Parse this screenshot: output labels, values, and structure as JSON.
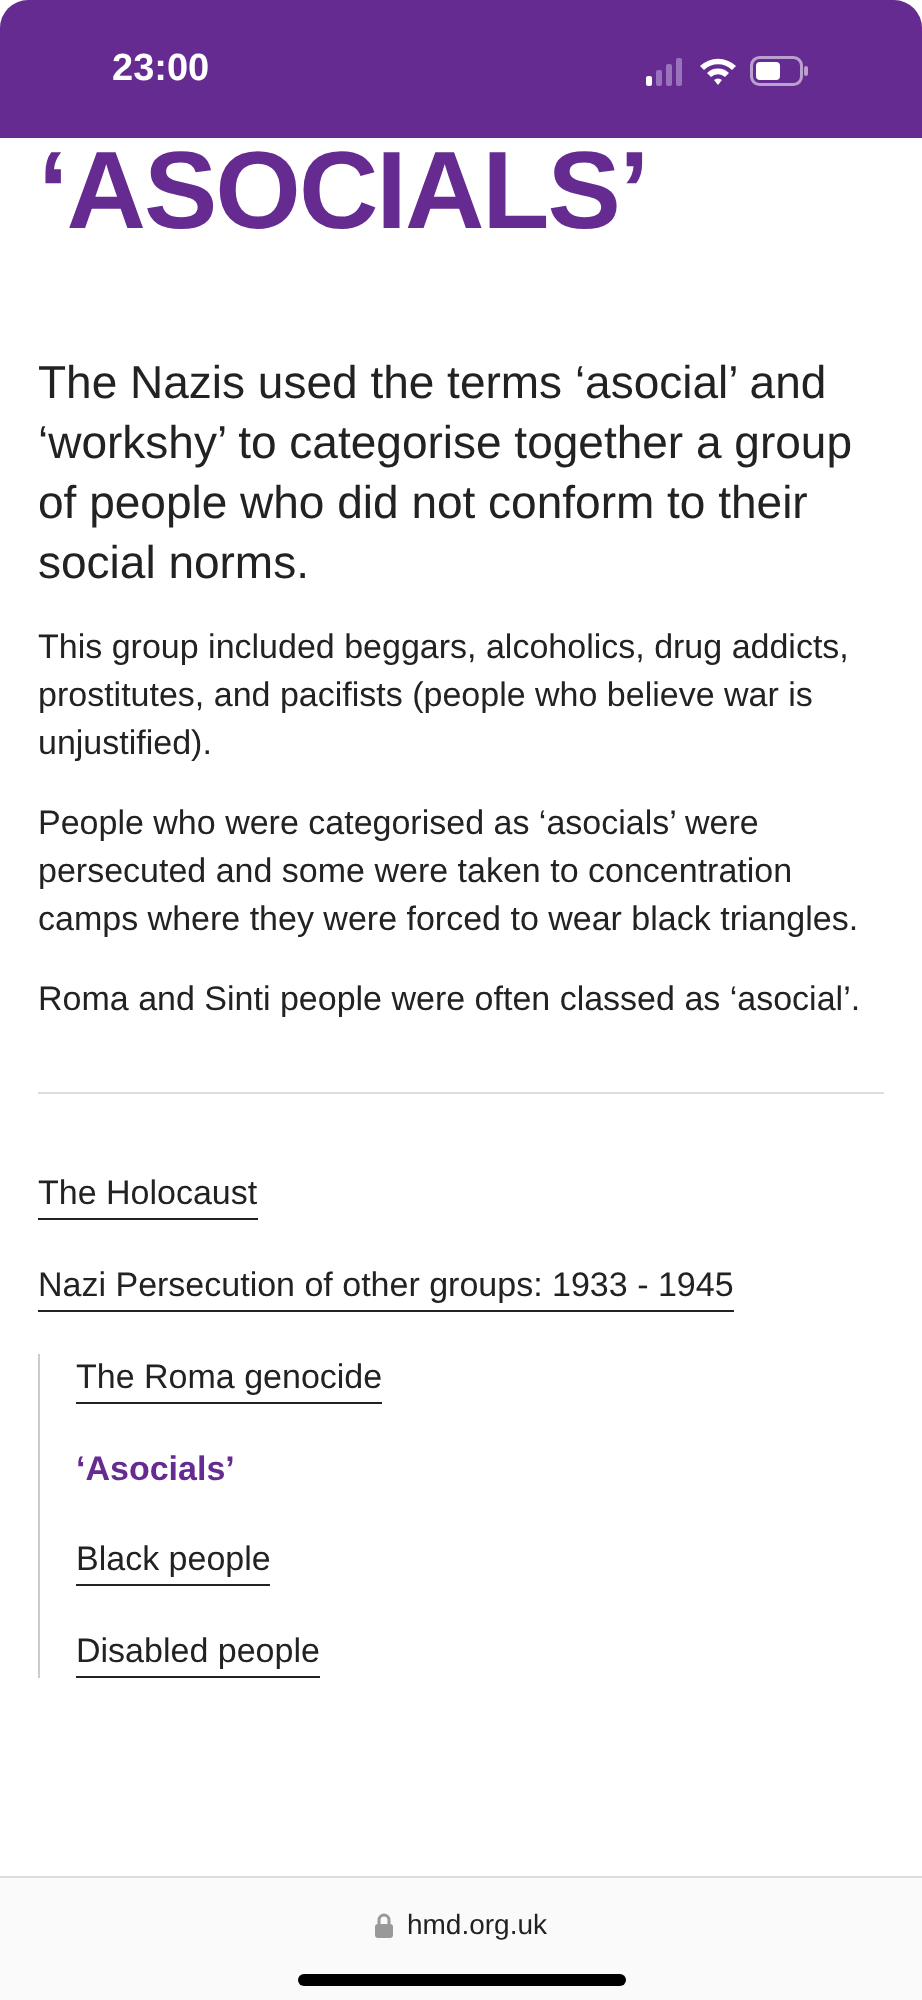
{
  "status_bar": {
    "time": "23:00"
  },
  "title": "‘ASOCIALS’",
  "lead": "The Nazis used the terms ‘asocial’ and ‘workshy’ to categorise together a group of people who did not conform to their social norms.",
  "paragraphs": [
    "This group included beggars, alcoholics, drug addicts, prostitutes, and pacifists (people who believe war is unjustified).",
    "People who were categorised as ‘asocials’ were persecuted and some were taken to concentration camps where they were forced to wear black triangles.",
    "Roma and Sinti people were often classed as ‘asocial’."
  ],
  "nav": [
    {
      "label": "The Holocaust",
      "selected": false
    },
    {
      "label": "Nazi Persecution of other groups: 1933 - 1945",
      "selected": false,
      "children": [
        {
          "label": "The Roma genocide",
          "selected": false
        },
        {
          "label": "‘Asocials’",
          "selected": true
        },
        {
          "label": "Black people",
          "selected": false
        },
        {
          "label": "Disabled people",
          "selected": false
        }
      ]
    }
  ],
  "address_bar": {
    "url": "hmd.org.uk"
  }
}
